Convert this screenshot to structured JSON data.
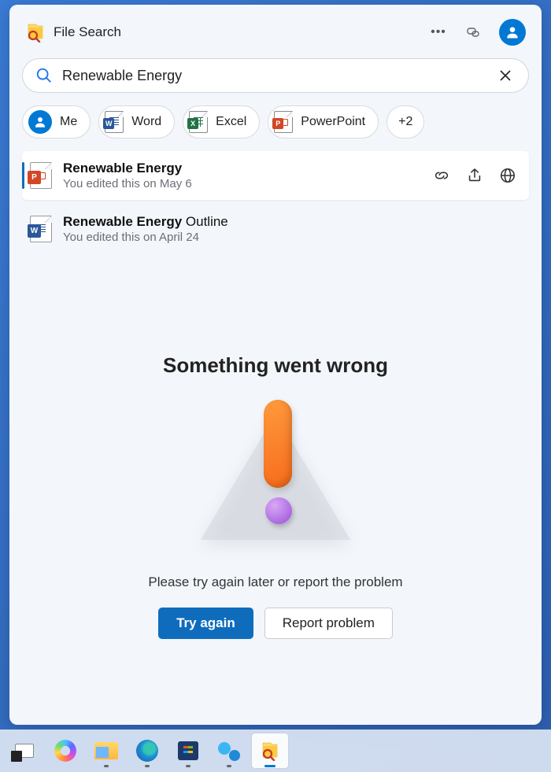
{
  "app": {
    "title": "File Search"
  },
  "search": {
    "value": "Renewable Energy"
  },
  "filters": {
    "me": "Me",
    "word": "Word",
    "excel": "Excel",
    "powerpoint": "PowerPoint",
    "more": "+2"
  },
  "results": [
    {
      "title_bold": "Renewable Energy",
      "title_rest": "",
      "subtitle": "You edited this on May 6",
      "type": "ppt",
      "selected": true
    },
    {
      "title_bold": "Renewable Energy",
      "title_rest": " Outline",
      "subtitle": "You edited this on April 24",
      "type": "word",
      "selected": false
    }
  ],
  "error": {
    "title": "Something went wrong",
    "subtitle": "Please try again later or report the problem",
    "retry": "Try again",
    "report": "Report problem"
  }
}
